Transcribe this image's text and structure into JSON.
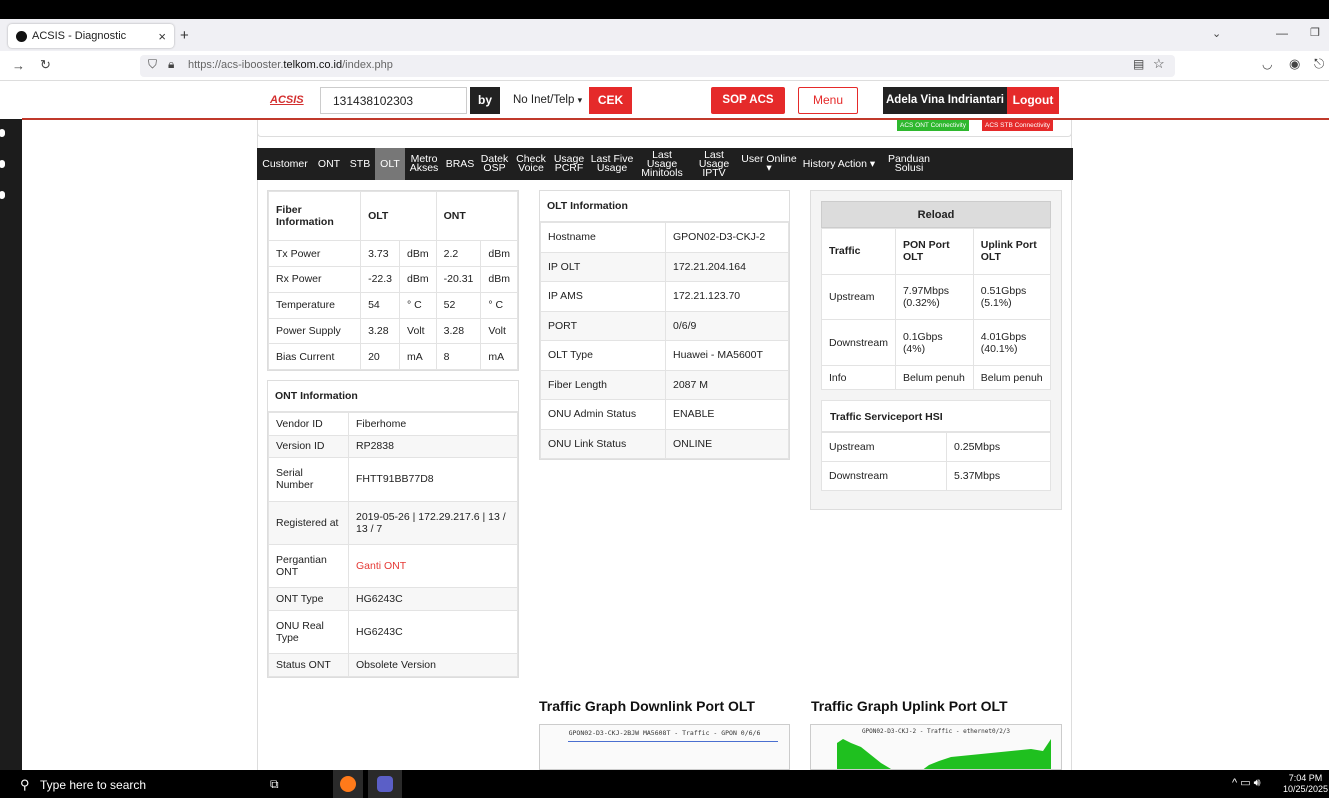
{
  "browser": {
    "tab_title": "ACSIS - Diagnostic",
    "tab_close": "×",
    "new_tab": "+",
    "url_prefix": "https://acs-ibooster.",
    "url_domain": "telkom.co.id",
    "url_path": "/index.php"
  },
  "header": {
    "logo": "ACSIS",
    "search_value": "131438102303",
    "by_label": "by",
    "select_value": "No Inet/Telp",
    "cek_label": "CEK",
    "sop_label": "SOP ACS",
    "menu_label": "Menu",
    "user_name": "Adela Vina Indriantari",
    "logout_label": "Logout"
  },
  "badges": {
    "ont": "ACS ONT Connectivity",
    "stb": "ACS STB Connectivity"
  },
  "nav_tabs": [
    {
      "l1": "Customer",
      "l2": ""
    },
    {
      "l1": "ONT",
      "l2": ""
    },
    {
      "l1": "STB",
      "l2": ""
    },
    {
      "l1": "OLT",
      "l2": ""
    },
    {
      "l1": "Metro",
      "l2": "Akses"
    },
    {
      "l1": "BRAS",
      "l2": ""
    },
    {
      "l1": "Datek",
      "l2": "OSP"
    },
    {
      "l1": "Check",
      "l2": "Voice"
    },
    {
      "l1": "Usage",
      "l2": "PCRF"
    },
    {
      "l1": "Last Five",
      "l2": "Usage"
    },
    {
      "l1": "Last Usage",
      "l2": "Minitools"
    },
    {
      "l1": "Last Usage",
      "l2": "IPTV"
    },
    {
      "l1": "User Online ▾",
      "l2": ""
    },
    {
      "l1": "History Action ▾",
      "l2": ""
    },
    {
      "l1": "Panduan",
      "l2": "Solusi"
    }
  ],
  "fiber": {
    "headers": [
      "Fiber Information",
      "OLT",
      "ONT"
    ],
    "rows": [
      [
        "Tx Power",
        "3.73",
        "dBm",
        "2.2",
        "dBm"
      ],
      [
        "Rx Power",
        "-22.3",
        "dBm",
        "-20.31",
        "dBm"
      ],
      [
        "Temperature",
        "54",
        "° C",
        "52",
        "° C"
      ],
      [
        "Power Supply",
        "3.28",
        "Volt",
        "3.28",
        "Volt"
      ],
      [
        "Bias Current",
        "20",
        "mA",
        "8",
        "mA"
      ]
    ]
  },
  "ont_info": {
    "title": "ONT Information",
    "rows": [
      [
        "Vendor ID",
        "Fiberhome"
      ],
      [
        "Version ID",
        "RP2838"
      ],
      [
        "Serial Number",
        "FHTT91BB77D8"
      ],
      [
        "Registered at",
        "2019-05-26 | 172.29.217.6 | 13 / 13 / 7"
      ],
      [
        "Pergantian ONT",
        "Ganti ONT"
      ],
      [
        "ONT Type",
        "HG6243C"
      ],
      [
        "ONU Real Type",
        "HG6243C"
      ],
      [
        "Status ONT",
        "Obsolete Version"
      ]
    ]
  },
  "olt_info": {
    "title": "OLT Information",
    "rows": [
      [
        "Hostname",
        "GPON02-D3-CKJ-2"
      ],
      [
        "IP OLT",
        "172.21.204.164"
      ],
      [
        "IP AMS",
        "172.21.123.70"
      ],
      [
        "PORT",
        "0/6/9"
      ],
      [
        "OLT Type",
        "Huawei - MA5600T"
      ],
      [
        "Fiber Length",
        "2087 M"
      ],
      [
        "ONU Admin Status",
        "ENABLE"
      ],
      [
        "ONU Link Status",
        "ONLINE"
      ]
    ]
  },
  "traffic": {
    "reload": "Reload",
    "headers": [
      "Traffic",
      "PON Port OLT",
      "Uplink Port OLT"
    ],
    "rows": [
      [
        "Upstream",
        "7.97Mbps (0.32%)",
        "0.51Gbps (5.1%)"
      ],
      [
        "Downstream",
        "0.1Gbps (4%)",
        "4.01Gbps (40.1%)"
      ],
      [
        "Info",
        "Belum penuh",
        "Belum penuh"
      ]
    ],
    "hsi_title": "Traffic Serviceport HSI",
    "hsi_rows": [
      [
        "Upstream",
        "0.25Mbps"
      ],
      [
        "Downstream",
        "5.37Mbps"
      ]
    ]
  },
  "graphs": {
    "down_title": "Traffic Graph Downlink Port OLT",
    "down_caption": "GPON02-D3-CKJ-2BJW MA5608T - Traffic - GPON 0/6/6",
    "up_title": "Traffic Graph Uplink Port OLT",
    "up_caption": "GPON02-D3-CKJ-2 - Traffic - ethernet0/2/3"
  },
  "taskbar": {
    "search": "Type here to search",
    "time": "7:04 PM",
    "date": "10/25/2025"
  }
}
